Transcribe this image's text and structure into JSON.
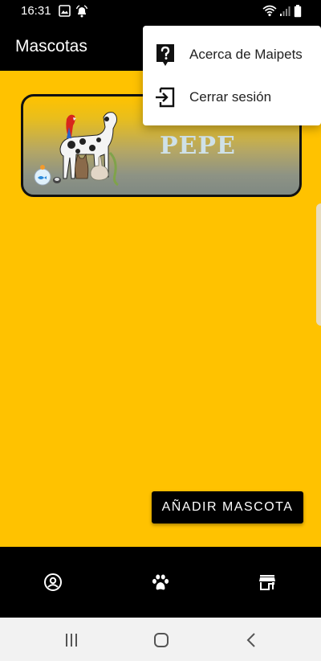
{
  "status_bar": {
    "time": "16:31",
    "icons": [
      "image-icon",
      "alarm-icon",
      "wifi-icon",
      "signal-icon",
      "battery-icon"
    ]
  },
  "app_bar": {
    "title": "Mascotas"
  },
  "overflow_menu": {
    "items": [
      {
        "label": "Acerca de Maipets",
        "icon": "help-icon"
      },
      {
        "label": "Cerrar sesión",
        "icon": "logout-icon"
      }
    ]
  },
  "pet_card": {
    "name": "PEPE",
    "image": "pets-group-image"
  },
  "actions": {
    "add_pet_label": "AÑADIR MASCOTA"
  },
  "bottom_nav": {
    "items": [
      {
        "icon": "account-icon"
      },
      {
        "icon": "paw-icon"
      },
      {
        "icon": "store-icon"
      }
    ]
  },
  "system_nav": {
    "items": [
      {
        "icon": "recents-icon"
      },
      {
        "icon": "home-icon"
      },
      {
        "icon": "back-icon"
      }
    ]
  },
  "colors": {
    "background": "#FFC200",
    "bars": "#000000",
    "pet_name": "#CFE1E8"
  }
}
